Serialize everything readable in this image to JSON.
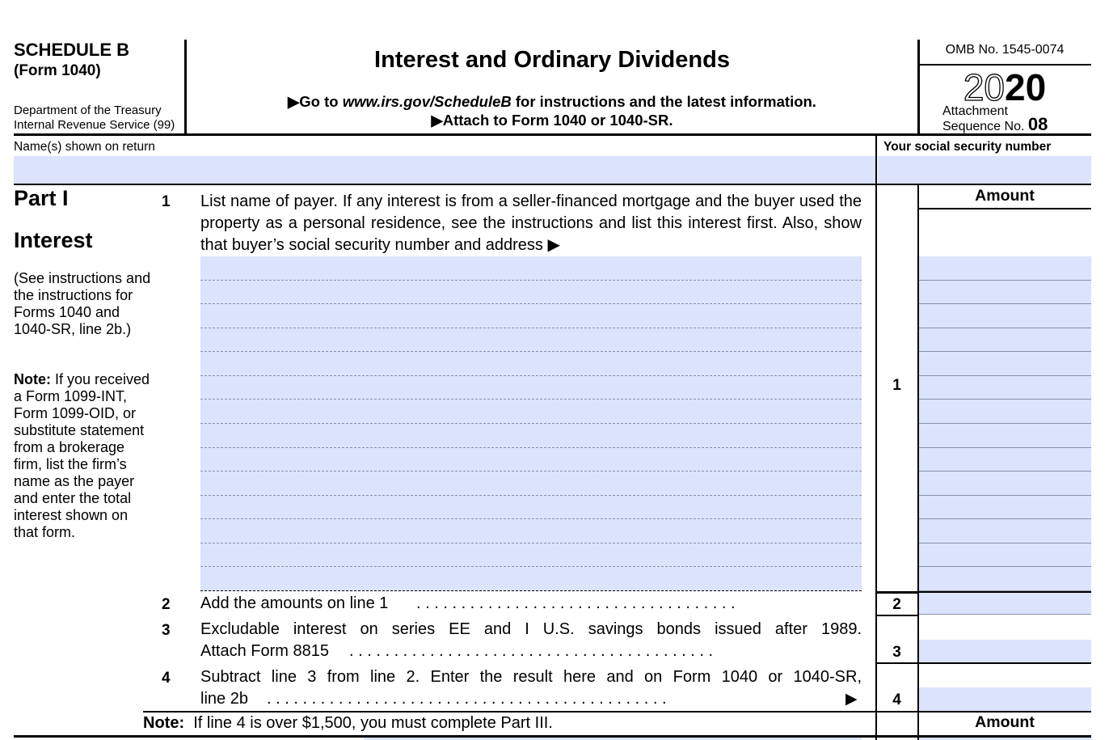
{
  "header": {
    "schedule_title": "SCHEDULE B",
    "schedule_form": "(Form 1040)",
    "department_line1": "Department of the Treasury",
    "department_line2": "Internal Revenue Service (99)",
    "form_title": "Interest and Ordinary Dividends",
    "goto_prefix": "▶Go to ",
    "goto_url": "www.irs.gov/ScheduleB",
    "goto_suffix": " for instructions and the latest information.",
    "attach_instruction": "▶Attach to Form 1040 or 1040-SR.",
    "omb_number": "OMB No. 1545-0074",
    "year_outline": "20",
    "year_bold": "20",
    "attachment_label": "Attachment",
    "sequence_label": "Sequence No.",
    "sequence_number": "08"
  },
  "taxpayer": {
    "name_label": "Name(s) shown on return",
    "name_value": "",
    "ssn_label": "Your social security number",
    "ssn_value": ""
  },
  "part1": {
    "part_label": "Part I",
    "part_name": "Interest",
    "side_note_instructions": "(See instructions and the instructions for Forms 1040 and 1040-SR, line 2b.)",
    "side_note_bold": "Note:",
    "side_note_text": " If you received a Form 1099-INT, Form 1099-OID, or substitute statement from a brokerage firm, list the firm’s name as the payer and enter the total interest shown on that form.",
    "amount_header": "Amount",
    "line1": {
      "number": "1",
      "text": "List name of payer. If any interest is from a seller-financed mortgage and the buyer used the property as a personal residence, see the instructions and list this interest first. Also, show that buyer’s social security number and address ▶",
      "payers": [
        {
          "name": "",
          "amount": ""
        },
        {
          "name": "",
          "amount": ""
        },
        {
          "name": "",
          "amount": ""
        },
        {
          "name": "",
          "amount": ""
        },
        {
          "name": "",
          "amount": ""
        },
        {
          "name": "",
          "amount": ""
        },
        {
          "name": "",
          "amount": ""
        },
        {
          "name": "",
          "amount": ""
        },
        {
          "name": "",
          "amount": ""
        },
        {
          "name": "",
          "amount": ""
        },
        {
          "name": "",
          "amount": ""
        },
        {
          "name": "",
          "amount": ""
        },
        {
          "name": "",
          "amount": ""
        },
        {
          "name": "",
          "amount": ""
        }
      ]
    },
    "line2": {
      "number": "2",
      "text": "Add the amounts on line 1",
      "dots": ". . . . . . . . . . . . . . . . . . . . . . . . . . . . . . . . . . . .",
      "amount": ""
    },
    "line3": {
      "number": "3",
      "text_line1": "Excludable interest on series EE and I U.S. savings bonds issued after 1989.",
      "text_line2": "Attach Form 8815",
      "dots": ". . . . . . . . . . . . . . . . . . . . . . . . . . . . . . . . . . . . . . . . .",
      "amount": ""
    },
    "line4": {
      "number": "4",
      "text_line1": "Subtract line 3 from line 2. Enter the result here and on Form 1040 or 1040-SR,",
      "text_line2": "line 2b",
      "dots": ". . . . . . . . . . . . . . . . . . . . . . . . . . . . . . . . . . . . . . . . . . . . .",
      "arrow": "▶",
      "amount": ""
    },
    "bottom_note_bold": "Note:",
    "bottom_note_text": "  If line 4 is over $1,500, you must complete Part III."
  },
  "part2": {
    "amount_header": "Amount"
  }
}
